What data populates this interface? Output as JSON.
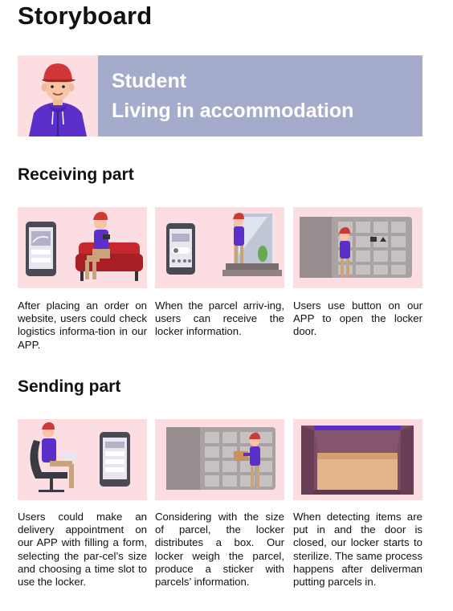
{
  "page": {
    "title": "Storyboard"
  },
  "persona": {
    "line1": "Student",
    "line2": "Living in accommodation",
    "colors": {
      "avatar_bg": "#fcdde2",
      "banner_bg": "#a5accb",
      "banner_text": "#ffffff"
    }
  },
  "sections": {
    "receiving": {
      "title": "Receiving part",
      "steps": [
        {
          "caption": "After placing an order on website, users could check logistics informa-tion in our APP.",
          "icon": "phone-and-person-on-sofa"
        },
        {
          "caption": "When the parcel arriv-ing, users can receive the locker information.",
          "icon": "phone-and-person-at-door"
        },
        {
          "caption": "Users use button on our APP to open the locker door.",
          "icon": "person-at-parcel-locker"
        }
      ]
    },
    "sending": {
      "title": "Sending part",
      "steps": [
        {
          "caption": "Users could make an delivery appointment on our APP with filling a form, selecting the par-cel’s size and choosing a time slot to use the locker.",
          "icon": "person-in-chair-and-phone"
        },
        {
          "caption": "Considering with the size of parcel, the locker distributes a box. Our locker weigh the parcel, produce a sticker with parcels’ information.",
          "icon": "person-placing-parcel-in-locker"
        },
        {
          "caption": "When detecting items are put in and the door is closed, our locker starts to sterilize. The same process happens after deliverman putting parcels in.",
          "icon": "locker-box-sterilizing"
        }
      ]
    }
  },
  "colors": {
    "card_bg": "#fcdde2",
    "accent_purple": "#5b2fc9",
    "cap_red": "#d03838",
    "locker_gray": "#a9a2a3"
  }
}
